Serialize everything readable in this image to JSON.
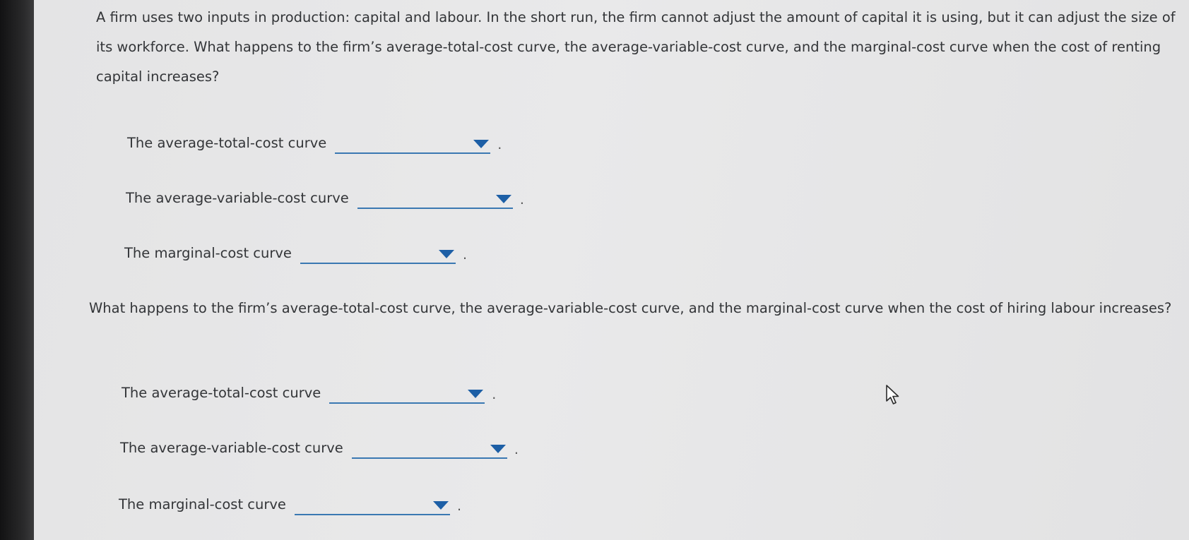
{
  "section1": {
    "question": "A firm uses two inputs in production: capital and labour. In the short run, the firm cannot adjust the amount of capital it is using, but it can adjust the size of its workforce. What happens to the firm’s average-total-cost curve, the average-variable-cost curve, and the marginal-cost curve when the cost of renting capital increases?",
    "rows": [
      {
        "label": "The average-total-cost curve",
        "selected": "",
        "suffix": "."
      },
      {
        "label": "The average-variable-cost curve",
        "selected": "",
        "suffix": "."
      },
      {
        "label": "The marginal-cost curve",
        "selected": "",
        "suffix": "."
      }
    ]
  },
  "section2": {
    "question": "What happens to the firm’s average-total-cost curve, the average-variable-cost curve, and the marginal-cost curve when the cost of hiring labour increases?",
    "rows": [
      {
        "label": "The average-total-cost curve",
        "selected": "",
        "suffix": "."
      },
      {
        "label": "The average-variable-cost curve",
        "selected": "",
        "suffix": "."
      },
      {
        "label": "The marginal-cost curve",
        "selected": "",
        "suffix": "."
      }
    ]
  },
  "icons": {
    "dropdown": "chevron-down-icon",
    "cursor": "mouse-pointer-icon"
  },
  "colors": {
    "accent": "#1d5fa6",
    "underline": "#3a78b2",
    "text": "#333538",
    "background": "#e7e7e8"
  }
}
